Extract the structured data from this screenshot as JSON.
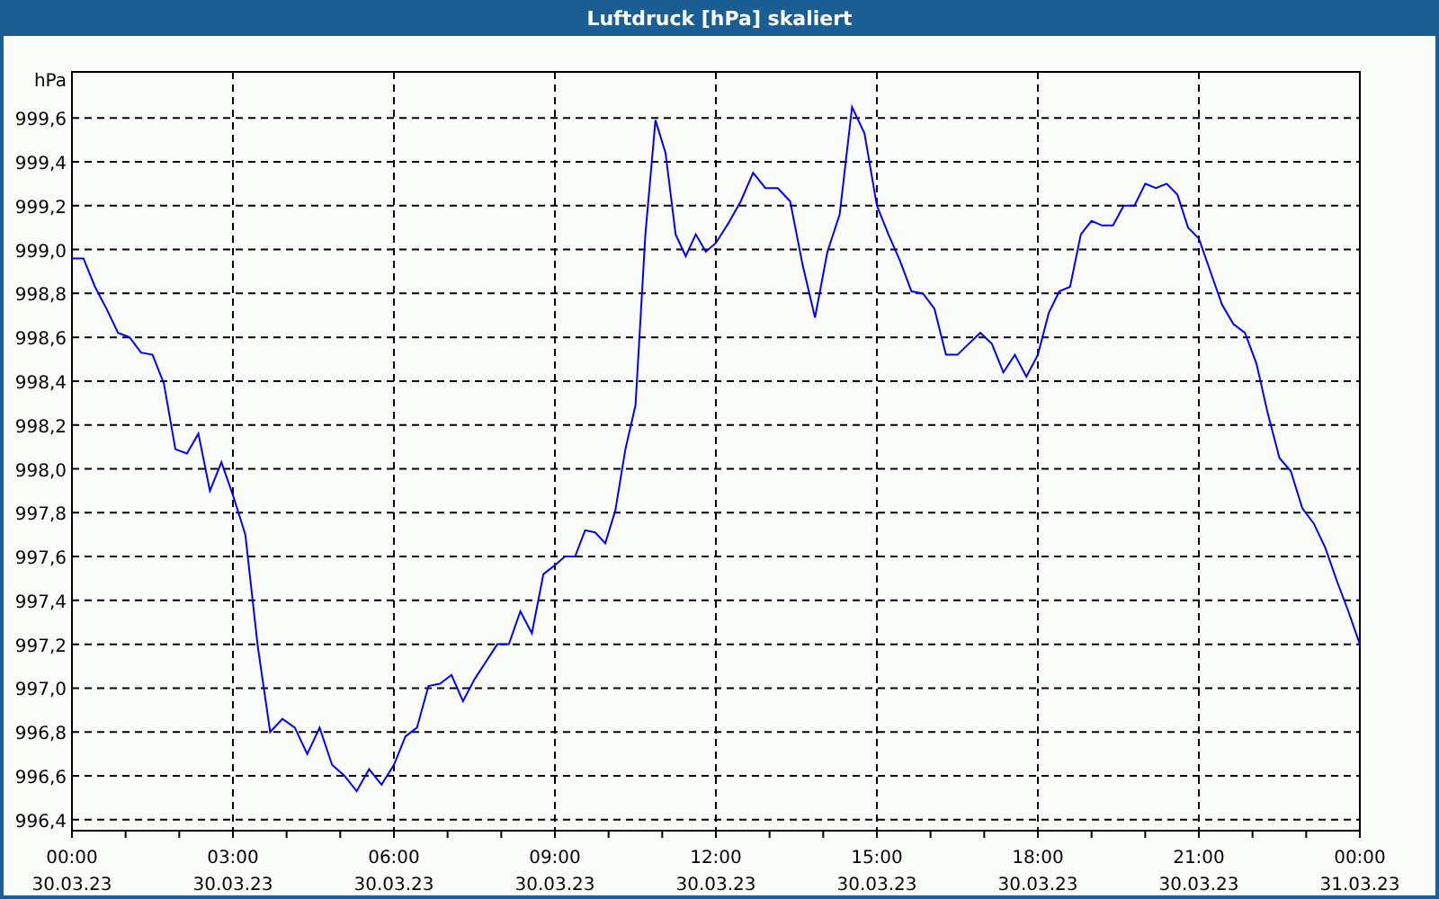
{
  "chart_data": {
    "type": "line",
    "title": "Luftdruck [hPa] skaliert",
    "ylabel": "hPa",
    "grid": true,
    "ylim": [
      996.35,
      999.81
    ],
    "categories": [
      "00:00 30.03.23",
      null,
      null,
      null,
      null,
      null,
      null,
      null,
      null,
      null,
      null,
      null,
      null,
      null,
      "03:00 30.03.23",
      null,
      null,
      null,
      null,
      null,
      null,
      null,
      null,
      null,
      null,
      null,
      null,
      "06:00 30.03.23",
      null,
      null,
      null,
      null,
      null,
      null,
      null,
      null,
      null,
      null,
      null,
      null,
      null,
      "09:00 30.03.23",
      null,
      null,
      null,
      null,
      null,
      null,
      null,
      null,
      null,
      null,
      null,
      null,
      null,
      null,
      null,
      "12:00 30.03.23",
      null,
      null,
      null,
      null,
      null,
      null,
      null,
      null,
      null,
      null,
      null,
      null,
      "15:00 30.03.23",
      null,
      null,
      null,
      null,
      null,
      null,
      null,
      null,
      null,
      null,
      null,
      null,
      null,
      "18:00 30.03.23",
      null,
      null,
      null,
      null,
      null,
      null,
      null,
      null,
      null,
      null,
      null,
      null,
      null,
      null,
      "21:00 30.03.23",
      null,
      null,
      null,
      null,
      null,
      null,
      null,
      null,
      null,
      null,
      null,
      null,
      null,
      "00:00 31.03.23"
    ],
    "yticks": [
      {
        "value": 999.6,
        "label": "999,6"
      },
      {
        "value": 999.4,
        "label": "999,4"
      },
      {
        "value": 999.2,
        "label": "999,2"
      },
      {
        "value": 999.0,
        "label": "999,0"
      },
      {
        "value": 998.8,
        "label": "998,8"
      },
      {
        "value": 998.6,
        "label": "998,6"
      },
      {
        "value": 998.4,
        "label": "998,4"
      },
      {
        "value": 998.2,
        "label": "998,2"
      },
      {
        "value": 998.0,
        "label": "998,0"
      },
      {
        "value": 997.8,
        "label": "997,8"
      },
      {
        "value": 997.6,
        "label": "997,6"
      },
      {
        "value": 997.4,
        "label": "997,4"
      },
      {
        "value": 997.2,
        "label": "997,2"
      },
      {
        "value": 997.0,
        "label": "997,0"
      },
      {
        "value": 996.8,
        "label": "996,8"
      },
      {
        "value": 996.6,
        "label": "996,6"
      },
      {
        "value": 996.4,
        "label": "996,4"
      }
    ],
    "series": [
      {
        "color": "#0000ff",
        "values": [
          998.96,
          998.96,
          998.83,
          998.73,
          998.62,
          998.6,
          998.53,
          998.52,
          998.39,
          998.09,
          998.07,
          998.16,
          997.9,
          998.03,
          997.88,
          997.7,
          997.19,
          996.8,
          996.86,
          996.82,
          996.7,
          996.82,
          996.65,
          996.6,
          996.53,
          996.63,
          996.56,
          996.65,
          996.78,
          996.82,
          997.01,
          997.02,
          997.06,
          996.94,
          997.04,
          997.12,
          997.2,
          997.2,
          997.35,
          997.25,
          997.52,
          997.56,
          997.6,
          997.6,
          997.72,
          997.71,
          997.66,
          997.81,
          998.09,
          998.29,
          999.07,
          999.59,
          999.44,
          999.07,
          998.97,
          999.07,
          998.99,
          999.03,
          999.12,
          999.22,
          999.35,
          999.28,
          999.28,
          999.22,
          998.93,
          998.69,
          998.99,
          999.16,
          999.65,
          999.53,
          999.2,
          999.07,
          998.95,
          998.81,
          998.8,
          998.73,
          998.52,
          998.52,
          998.57,
          998.62,
          998.57,
          998.44,
          998.52,
          998.42,
          998.52,
          998.71,
          998.81,
          998.83,
          999.07,
          999.13,
          999.11,
          999.11,
          999.2,
          999.2,
          999.3,
          999.28,
          999.3,
          999.25,
          999.1,
          999.05,
          998.9,
          998.75,
          998.66,
          998.62,
          998.48,
          998.25,
          998.05,
          997.99,
          997.82,
          997.75,
          997.64,
          997.49,
          997.35,
          997.2
        ]
      }
    ]
  }
}
